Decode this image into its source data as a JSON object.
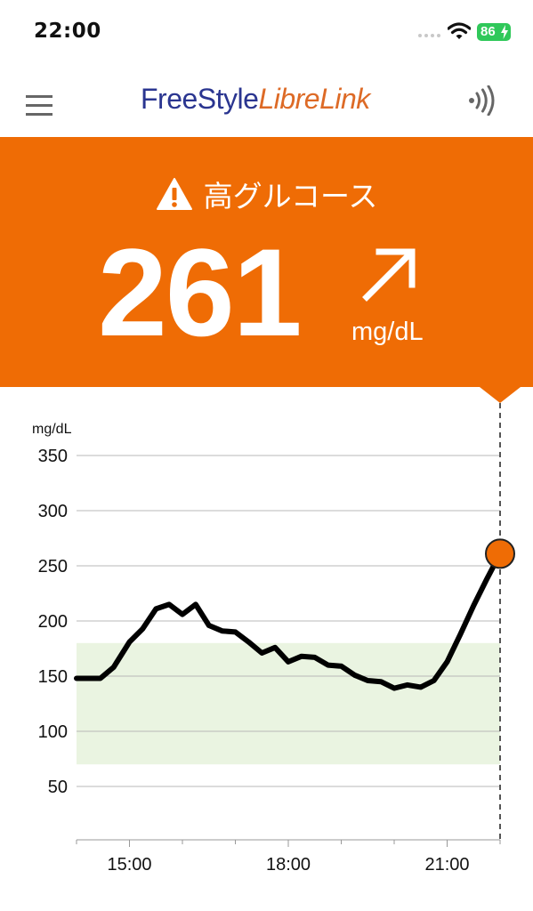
{
  "status_bar": {
    "time": "22:00",
    "battery_level": "86",
    "icons": [
      "signal-dots-icon",
      "wifi-icon",
      "battery-charging-icon"
    ]
  },
  "header": {
    "logo_text_primary": "FreeStyle",
    "logo_text_secondary": "LibreLink",
    "menu_icon": "hamburger-menu-icon",
    "scan_icon": "nfc-scan-icon"
  },
  "reading": {
    "alert_label": "高グルコース",
    "alert_icon": "warning-icon",
    "value": "261",
    "unit": "mg/dL",
    "trend": "rising",
    "trend_icon": "arrow-up-right-icon",
    "panel_color": "#ef6c05"
  },
  "chart_data": {
    "type": "line",
    "ylabel": "mg/dL",
    "ylim": [
      0,
      350
    ],
    "y_ticks": [
      50,
      100,
      150,
      200,
      250,
      300,
      350
    ],
    "x_ticks": [
      "15:00",
      "18:00",
      "21:00"
    ],
    "xlim_hours": [
      14.0,
      22.0
    ],
    "grid": true,
    "target_range": [
      70,
      180
    ],
    "target_range_color": "#eaf4e1",
    "line_color": "#000000",
    "current_point_color": "#ef6c05",
    "series": [
      {
        "x": [
          14.0,
          14.45,
          14.7,
          15.0,
          15.25,
          15.5,
          15.75,
          16.0,
          16.25,
          16.5,
          16.75,
          17.0,
          17.25,
          17.5,
          17.75,
          18.0,
          18.25,
          18.5,
          18.75,
          19.0,
          19.25,
          19.5,
          19.75,
          20.0,
          20.25,
          20.5,
          20.75,
          21.0,
          21.25,
          21.5,
          21.75,
          22.0
        ],
        "y": [
          148,
          148,
          158,
          181,
          193,
          211,
          215,
          206,
          215,
          196,
          191,
          190,
          181,
          171,
          176,
          163,
          168,
          167,
          160,
          159,
          151,
          146,
          145,
          139,
          142,
          140,
          146,
          163,
          188,
          214,
          238,
          261
        ]
      }
    ],
    "current_value": {
      "x": 22.0,
      "y": 261
    }
  }
}
